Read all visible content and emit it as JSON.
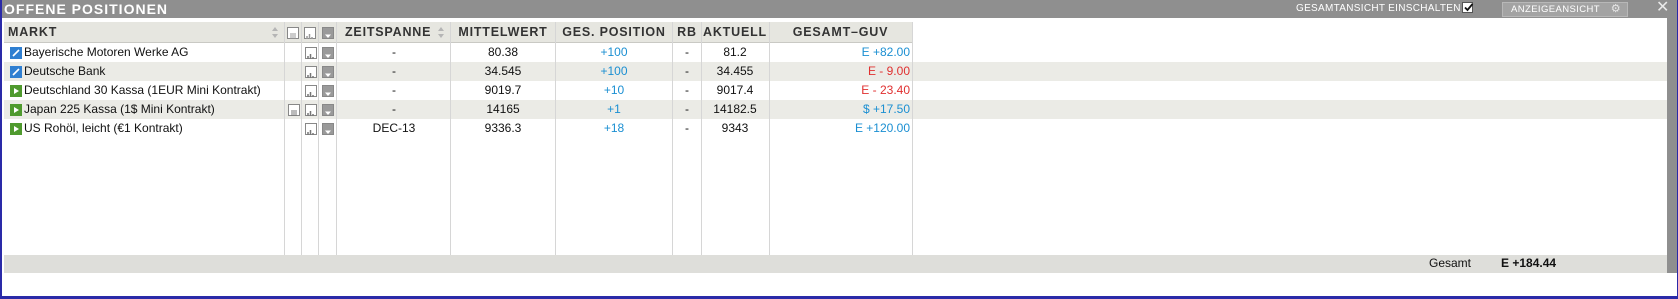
{
  "window": {
    "title": "OFFENE POSITIONEN",
    "overall_view_label": "GESAMTANSICHT EINSCHALTEN",
    "overall_view_checked": true,
    "display_view_button": "ANZEIGEANSICHT",
    "close_symbol": "✕"
  },
  "columns": {
    "market": "MARKT",
    "timespan": "ZEITSPANNE",
    "mean": "MITTELWERT",
    "total_position": "GES. POSITION",
    "rb": "RB",
    "current": "AKTUELL",
    "total_pnl": "GESAMT–GUV"
  },
  "rows": [
    {
      "market": "Bayerische Motoren Werke AG",
      "icon": "pencil-icon",
      "has_note": false,
      "timespan": "-",
      "mean": "80.38",
      "position": "+100",
      "rb": "-",
      "current": "81.2",
      "pnl": "E +82.00",
      "pnl_color": "blue"
    },
    {
      "market": "Deutsche Bank",
      "icon": "pencil-icon",
      "has_note": false,
      "timespan": "-",
      "mean": "34.545",
      "position": "+100",
      "rb": "-",
      "current": "34.455",
      "pnl": "E - 9.00",
      "pnl_color": "red"
    },
    {
      "market": "Deutschland 30 Kassa (1EUR Mini Kontrakt)",
      "icon": "play-icon",
      "has_note": false,
      "timespan": "-",
      "mean": "9019.7",
      "position": "+10",
      "rb": "-",
      "current": "9017.4",
      "pnl": "E - 23.40",
      "pnl_color": "red"
    },
    {
      "market": "Japan 225 Kassa (1$ Mini Kontrakt)",
      "icon": "play-icon",
      "has_note": true,
      "timespan": "-",
      "mean": "14165",
      "position": "+1",
      "rb": "-",
      "current": "14182.5",
      "pnl": "$ +17.50",
      "pnl_color": "blue"
    },
    {
      "market": "US Rohöl, leicht (€1 Kontrakt)",
      "icon": "play-icon",
      "has_note": false,
      "timespan": "DEC-13",
      "mean": "9336.3",
      "position": "+18",
      "rb": "-",
      "current": "9343",
      "pnl": "E +120.00",
      "pnl_color": "blue"
    }
  ],
  "footer": {
    "total_label": "Gesamt",
    "total_value": "E +184.44"
  },
  "colors": {
    "blue": "#1b8fd2",
    "red": "#e03030",
    "pencil": "#2f7fd1",
    "play": "#4f9a2e"
  }
}
